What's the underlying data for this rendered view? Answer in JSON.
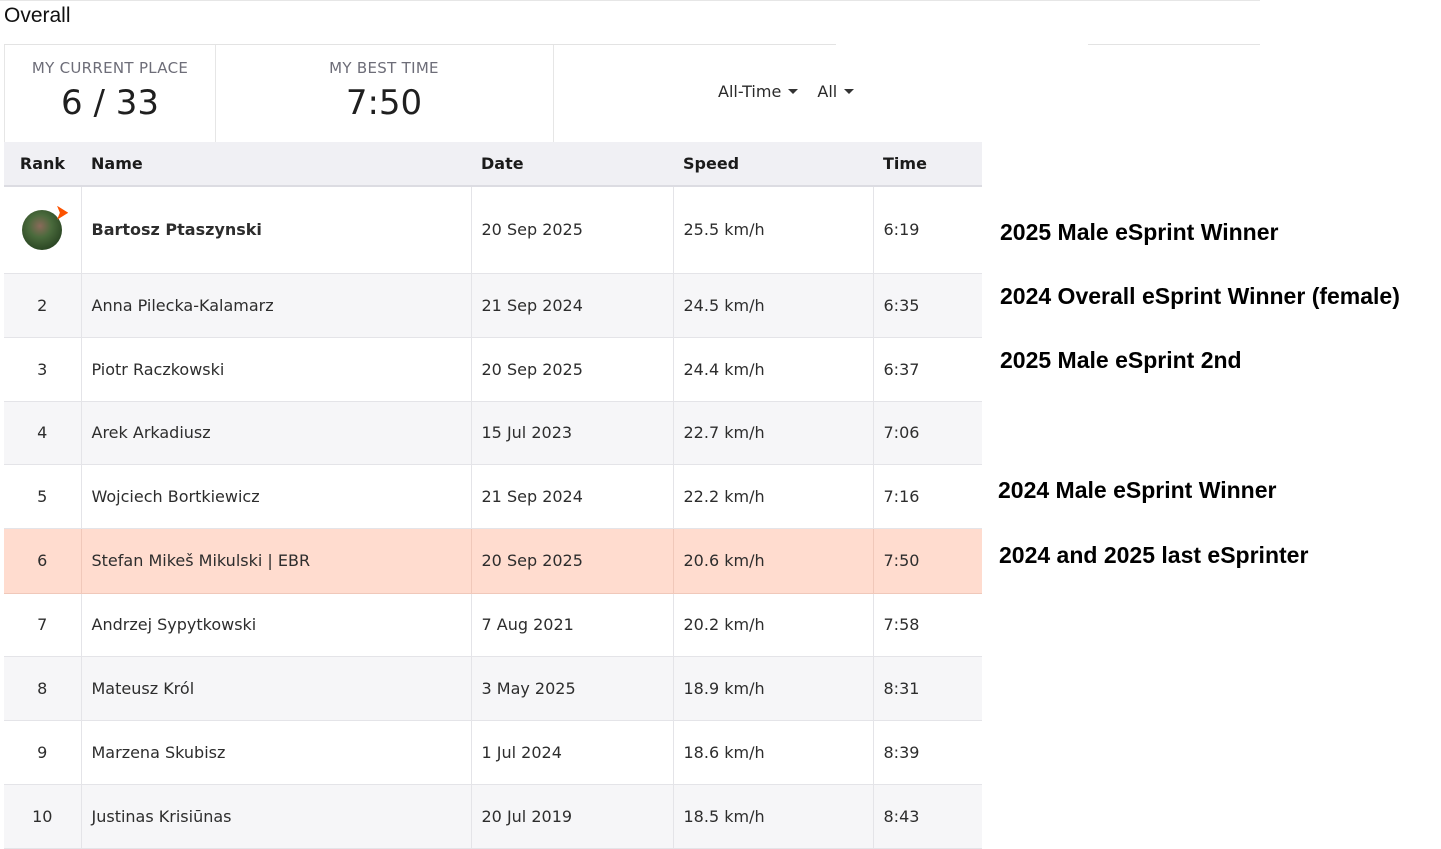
{
  "page": {
    "title": "Overall"
  },
  "stats": {
    "current_place": {
      "label": "MY CURRENT PLACE",
      "value": "6 / 33"
    },
    "best_time": {
      "label": "MY BEST TIME",
      "value": "7:50"
    }
  },
  "filters": {
    "period": "All-Time",
    "group": "All"
  },
  "table": {
    "headers": {
      "rank": "Rank",
      "name": "Name",
      "date": "Date",
      "speed": "Speed",
      "time": "Time"
    },
    "rows": [
      {
        "rank": "",
        "name": "Bartosz Ptaszynski",
        "date": "20 Sep 2025",
        "speed": "25.5 km/h",
        "time": "6:19"
      },
      {
        "rank": "2",
        "name": "Anna Pilecka-Kalamarz",
        "date": "21 Sep 2024",
        "speed": "24.5 km/h",
        "time": "6:35"
      },
      {
        "rank": "3",
        "name": "Piotr Raczkowski",
        "date": "20 Sep 2025",
        "speed": "24.4 km/h",
        "time": "6:37"
      },
      {
        "rank": "4",
        "name": "Arek Arkadiusz",
        "date": "15 Jul 2023",
        "speed": "22.7 km/h",
        "time": "7:06"
      },
      {
        "rank": "5",
        "name": "Wojciech Bortkiewicz",
        "date": "21 Sep 2024",
        "speed": "22.2 km/h",
        "time": "7:16"
      },
      {
        "rank": "6",
        "name": "Stefan Mikeš Mikulski | EBR",
        "date": "20 Sep 2025",
        "speed": "20.6 km/h",
        "time": "7:50"
      },
      {
        "rank": "7",
        "name": "Andrzej Sypytkowski",
        "date": "7 Aug 2021",
        "speed": "20.2 km/h",
        "time": "7:58"
      },
      {
        "rank": "8",
        "name": "Mateusz Król",
        "date": "3 May 2025",
        "speed": "18.9 km/h",
        "time": "8:31"
      },
      {
        "rank": "9",
        "name": "Marzena Skubisz",
        "date": "1 Jul 2024",
        "speed": "18.6 km/h",
        "time": "8:39"
      },
      {
        "rank": "10",
        "name": "Justinas Krisiūnas",
        "date": "20 Jul 2019",
        "speed": "18.5 km/h",
        "time": "8:43"
      }
    ]
  },
  "annotations": [
    "2025 Male eSprint Winner",
    "2024 Overall eSprint Winner (female)",
    "2025 Male eSprint 2nd",
    "2024 Male eSprint Winner",
    "2024 and 2025 last eSprinter"
  ],
  "colors": {
    "accent_link": "#137896",
    "highlight_row": "#ffdccf",
    "badge": "#fc5200"
  }
}
